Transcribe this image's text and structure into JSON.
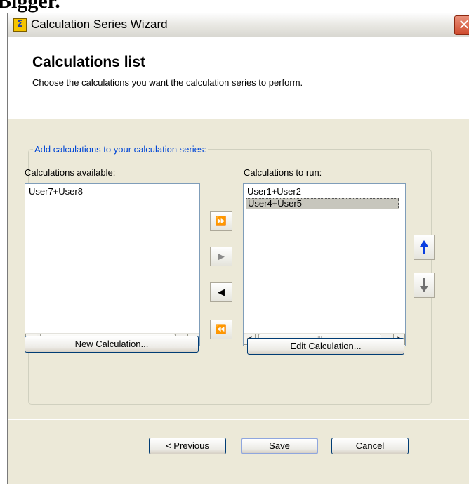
{
  "partial_text": "Bigger.",
  "window": {
    "title": "Calculation Series Wizard",
    "close_glyph": "✕"
  },
  "header": {
    "title": "Calculations list",
    "subtitle": "Choose the calculations you want the calculation series to perform."
  },
  "group": {
    "label": "Add calculations to your calculation series:",
    "available_label": "Calculations available:",
    "to_run_label": "Calculations to run:",
    "available_items": [
      "User7+User8"
    ],
    "to_run_items": [
      "User1+User2",
      "User4+User5"
    ],
    "selected_to_run_index": 1,
    "new_calc_button": "New Calculation...",
    "edit_calc_button": "Edit Calculation...",
    "scroll_left": "<",
    "scroll_right": ">",
    "scroll_thumb": "III"
  },
  "transfer_buttons": {
    "add_all": "⏩",
    "add": "▶",
    "remove": "◀",
    "remove_all": "⏪"
  },
  "footer": {
    "previous": "< Previous",
    "save": "Save",
    "cancel": "Cancel"
  },
  "icons": {
    "app": "app-icon",
    "move_up": "arrow-up-icon",
    "move_down": "arrow-down-icon"
  },
  "colors": {
    "accent_blue": "#0046d5",
    "move_up_arrow": "#0a3fe0",
    "move_down_arrow": "#6f6f6f",
    "window_bg": "#ece9d8"
  }
}
